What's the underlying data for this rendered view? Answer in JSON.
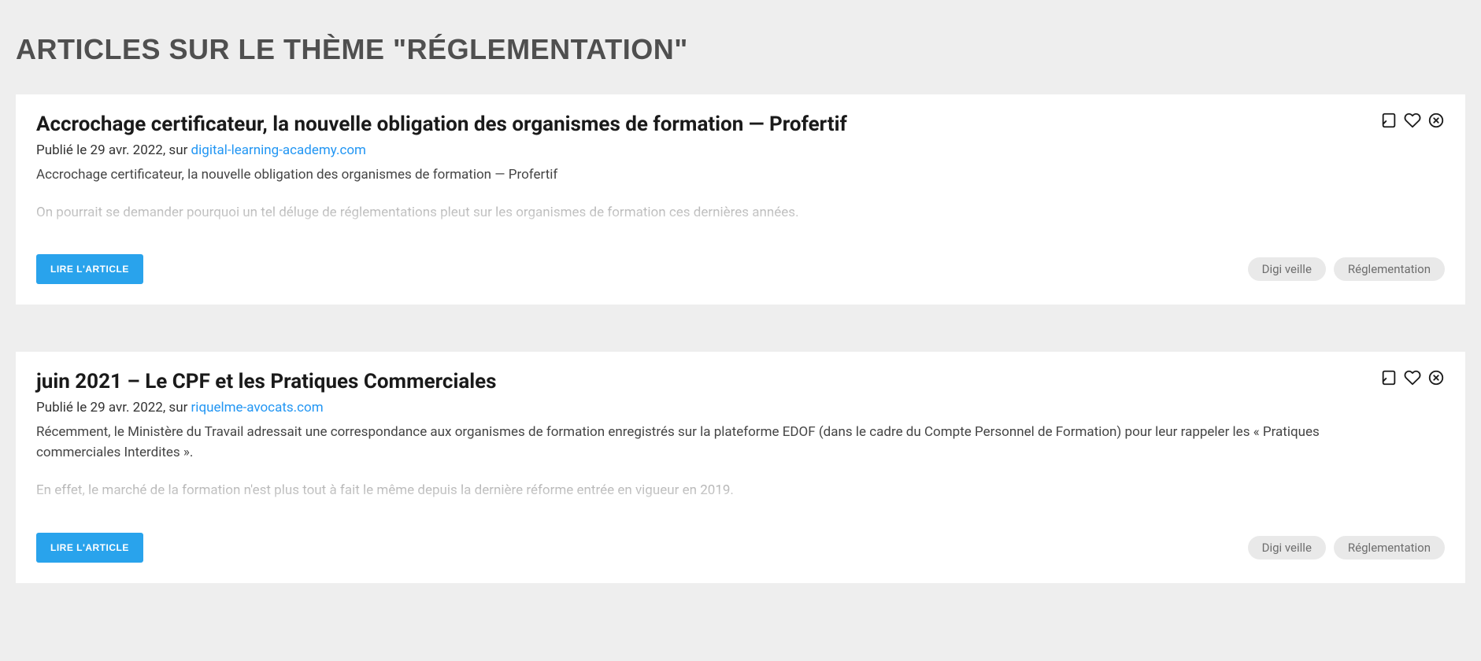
{
  "page": {
    "heading": "ARTICLES SUR LE THÈME \"RÉGLEMENTATION\""
  },
  "common": {
    "read_button": "LIRE L'ARTICLE",
    "meta_prefix": "Publié le ",
    "meta_separator": ", sur "
  },
  "articles": [
    {
      "title": "Accrochage certificateur, la nouvelle obligation des organismes de formation — Profertif",
      "published": "29 avr. 2022",
      "source": "digital-learning-academy.com",
      "excerpt": [
        {
          "text": "Accrochage certificateur, la nouvelle obligation des organismes de formation — Profertif",
          "muted": false
        },
        {
          "text": "On pourrait se demander pourquoi un tel déluge de réglementations pleut sur les organismes de formation ces dernières années.",
          "muted": true
        }
      ],
      "tags": [
        "Digi veille",
        "Réglementation"
      ]
    },
    {
      "title": "juin 2021 – Le CPF et les Pratiques Commerciales",
      "published": "29 avr. 2022",
      "source": "riquelme-avocats.com",
      "excerpt": [
        {
          "text": "Récemment, le Ministère du Travail adressait une correspondance aux organismes de formation enregistrés sur la plateforme EDOF (dans le cadre du Compte Personnel de Formation) pour leur rappeler les « Pratiques commerciales Interdites ».",
          "muted": false
        },
        {
          "text": "En effet, le marché de la formation n'est plus tout à fait le même depuis la dernière réforme entrée en vigueur en 2019.",
          "muted": true
        }
      ],
      "tags": [
        "Digi veille",
        "Réglementation"
      ]
    }
  ]
}
